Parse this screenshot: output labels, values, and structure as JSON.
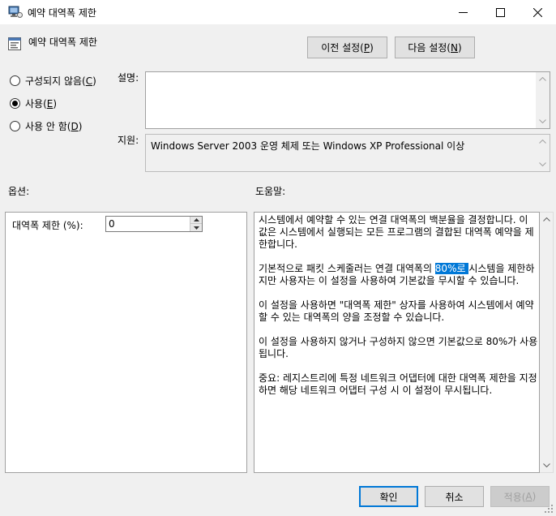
{
  "window": {
    "title": "예약 대역폭 제한",
    "minimize_glyph": "—",
    "maximize_glyph": "☐",
    "close_glyph": "✕"
  },
  "header": {
    "policy_title": "예약 대역폭 제한",
    "prev_setting": {
      "text": "이전 설정(",
      "key": "P",
      "end": ")"
    },
    "next_setting": {
      "text": "다음 설정(",
      "key": "N",
      "end": ")"
    }
  },
  "radios": {
    "not_configured": {
      "text": "구성되지 않음(",
      "key": "C",
      "end": ")",
      "checked": false
    },
    "enabled": {
      "text": "사용(",
      "key": "E",
      "end": ")",
      "checked": true
    },
    "disabled": {
      "text": "사용 안 함(",
      "key": "D",
      "end": ")",
      "checked": false
    }
  },
  "description": {
    "label": "설명:",
    "value": ""
  },
  "supported_on": {
    "label": "지원:",
    "value": "Windows Server 2003 운영 체제 또는 Windows XP Professional 이상"
  },
  "options": {
    "label": "옵션:",
    "bandwidth_label": "대역폭 제한 (%):",
    "bandwidth_value": "0"
  },
  "help": {
    "label": "도움말:",
    "p1": "시스템에서 예약할 수 있는 연결 대역폭의 백분율을 결정합니다. 이 값은 시스템에서 실행되는 모든 프로그램의 결합된 대역폭 예약을 제한합니다.",
    "p2_before": "기본적으로 패킷 스케줄러는 연결 대역폭의 ",
    "p2_selected": "80%로 ",
    "p2_after": "시스템을 제한하지만 사용자는 이 설정을 사용하여 기본값을 무시할 수 있습니다.",
    "p3": "이 설정을 사용하면 \"대역폭 제한\" 상자를 사용하여 시스템에서 예약할 수 있는 대역폭의 양을 조정할 수 있습니다.",
    "p4": "이 설정을 사용하지 않거나 구성하지 않으면 기본값으로 80%가 사용됩니다.",
    "p5": "중요: 레지스트리에 특정 네트워크 어댑터에 대한 대역폭 제한을 지정하면 해당 네트워크 어댑터 구성 시 이 설정이 무시됩니다."
  },
  "footer": {
    "ok": "확인",
    "cancel": "취소",
    "apply": {
      "text": "적용(",
      "key": "A",
      "end": ")"
    }
  },
  "colors": {
    "accent": "#0078d7",
    "window_bg": "#f0f0f0"
  }
}
